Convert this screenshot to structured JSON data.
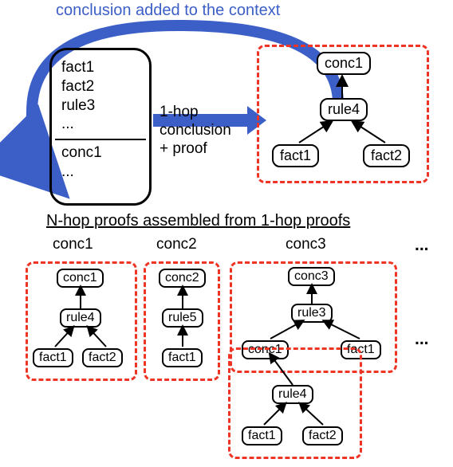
{
  "top_label": "conclusion added to the context",
  "context_items": {
    "i0": "fact1",
    "i1": "fact2",
    "i2": "rule3",
    "i3": "...",
    "i4": "conc1",
    "i5": "..."
  },
  "arrow_label": {
    "l1": "1-hop",
    "l2": "conclusion",
    "l3": "+ proof"
  },
  "nodes": {
    "conc1": "conc1",
    "conc2": "conc2",
    "conc3": "conc3",
    "rule3": "rule3",
    "rule4": "rule4",
    "rule5": "rule5",
    "fact1": "fact1",
    "fact2": "fact2"
  },
  "subhead": "N-hop proofs assembled from 1-hop proofs",
  "col_labels": {
    "c1": "conc1",
    "c2": "conc2",
    "c3": "conc3"
  },
  "ellipsis": "..."
}
